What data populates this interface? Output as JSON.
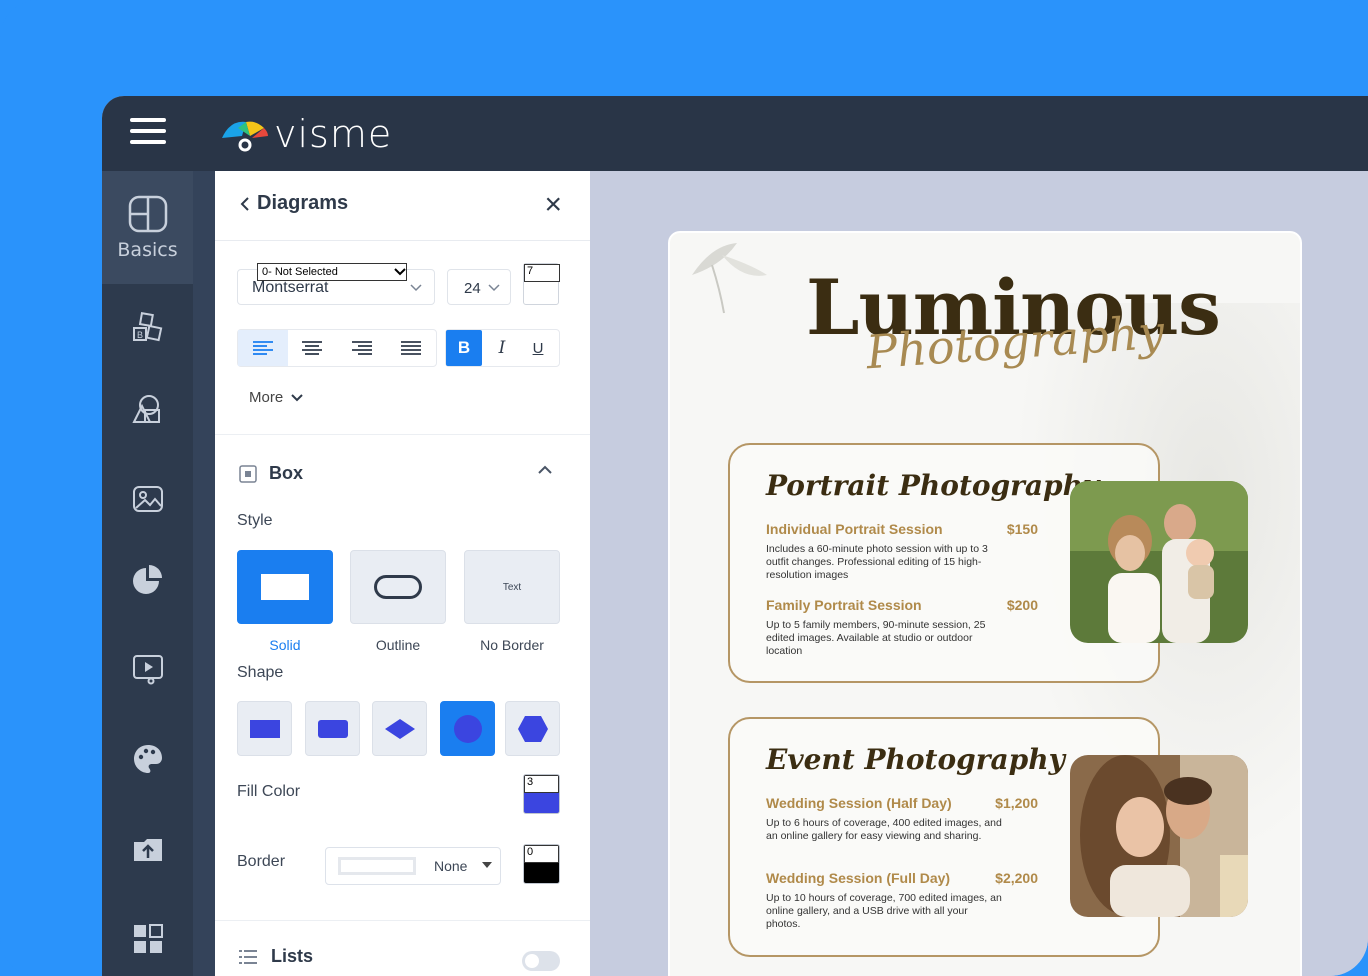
{
  "app": {
    "logo_text": "visme"
  },
  "rail": {
    "basics_label": "Basics"
  },
  "panel": {
    "title": "Diagrams",
    "font": {
      "native_select": "0- Not Selected",
      "family": "Montserrat",
      "size": "24",
      "line_value": "7"
    },
    "format": {
      "bold": "B",
      "italic": "I",
      "underline": "U"
    },
    "more_label": "More",
    "box": {
      "title": "Box",
      "style_label": "Style",
      "styles": [
        "Solid",
        "Outline",
        "No Border"
      ],
      "no_border_preview": "Text",
      "shape_label": "Shape",
      "fill_label": "Fill Color",
      "fill_value": "3",
      "border_label": "Border",
      "border_option": "None",
      "border_value": "0"
    },
    "lists_label": "Lists"
  },
  "document": {
    "title": "Luminous",
    "subtitle": "Photography",
    "cards": [
      {
        "title": "Portrait Photography",
        "items": [
          {
            "name": "Individual Portrait Session",
            "price": "$150",
            "desc": "Includes a 60-minute photo session with up to 3 outfit changes. Professional editing of 15 high-resolution images"
          },
          {
            "name": "Family Portrait Session",
            "price": "$200",
            "desc": "Up to 5 family members, 90-minute session, 25 edited images. Available at studio or outdoor location"
          }
        ]
      },
      {
        "title": "Event Photography",
        "items": [
          {
            "name": "Wedding Session (Half Day)",
            "price": "$1,200",
            "desc": "Up to 6 hours of coverage, 400 edited images, and an online gallery for easy viewing and sharing."
          },
          {
            "name": "Wedding Session  (Full Day)",
            "price": "$2,200",
            "desc": "Up to 10 hours of coverage, 700 edited images, an online gallery, and a USB drive with all your photos."
          }
        ]
      }
    ]
  },
  "colors": {
    "accent": "#1a7ef0",
    "frame": "#2a93fb",
    "topbar": "#293547",
    "gold": "#b08a4a",
    "shape": "#3b45e0"
  }
}
